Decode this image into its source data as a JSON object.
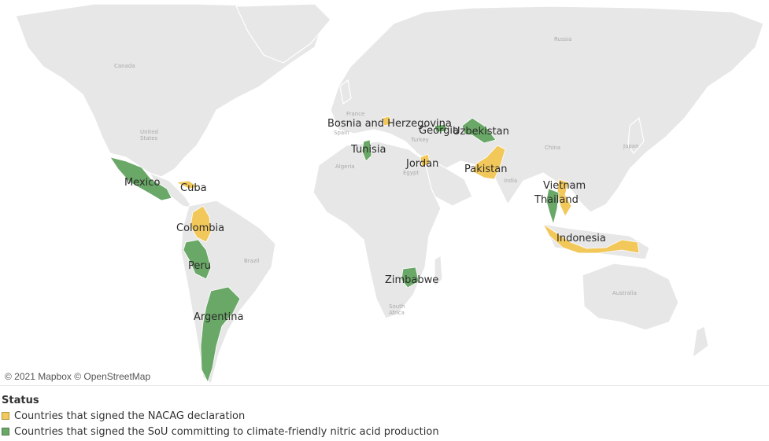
{
  "map": {
    "attribution": "© 2021 Mapbox © OpenStreetMap",
    "base_labels": {
      "canada": "Canada",
      "united_states_1": "United",
      "united_states_2": "States",
      "russia": "Russia",
      "china": "China",
      "india": "India",
      "brazil": "Brazil",
      "australia": "Australia",
      "algeria": "Algeria",
      "egypt": "Egypt",
      "south_africa_1": "South",
      "south_africa_2": "Africa",
      "spain": "Spain",
      "france": "France",
      "turkey": "Turkey",
      "japan": "Japan"
    },
    "countries": [
      {
        "name": "Bosnia and Herzegovina",
        "status": "nacag"
      },
      {
        "name": "Georgia",
        "status": "sou"
      },
      {
        "name": "Uzbekistan",
        "status": "sou"
      },
      {
        "name": "Tunisia",
        "status": "sou"
      },
      {
        "name": "Jordan",
        "status": "nacag"
      },
      {
        "name": "Pakistan",
        "status": "nacag"
      },
      {
        "name": "Mexico",
        "status": "sou"
      },
      {
        "name": "Cuba",
        "status": "nacag"
      },
      {
        "name": "Vietnam",
        "status": "nacag"
      },
      {
        "name": "Thailand",
        "status": "sou"
      },
      {
        "name": "Colombia",
        "status": "nacag"
      },
      {
        "name": "Indonesia",
        "status": "nacag"
      },
      {
        "name": "Peru",
        "status": "sou"
      },
      {
        "name": "Zimbabwe",
        "status": "sou"
      },
      {
        "name": "Argentina",
        "status": "sou"
      }
    ]
  },
  "legend": {
    "title": "Status",
    "items": [
      {
        "key": "nacag",
        "label": "Countries that signed the NACAG declaration",
        "color": "#f2c85b"
      },
      {
        "key": "sou",
        "label": "Countries that signed the SoU committing to climate-friendly nitric acid production",
        "color": "#6aa867"
      }
    ]
  },
  "colors": {
    "land": "#e7e7e7",
    "background": "#ffffff",
    "nacag": "#f2c85b",
    "sou": "#6aa867"
  }
}
